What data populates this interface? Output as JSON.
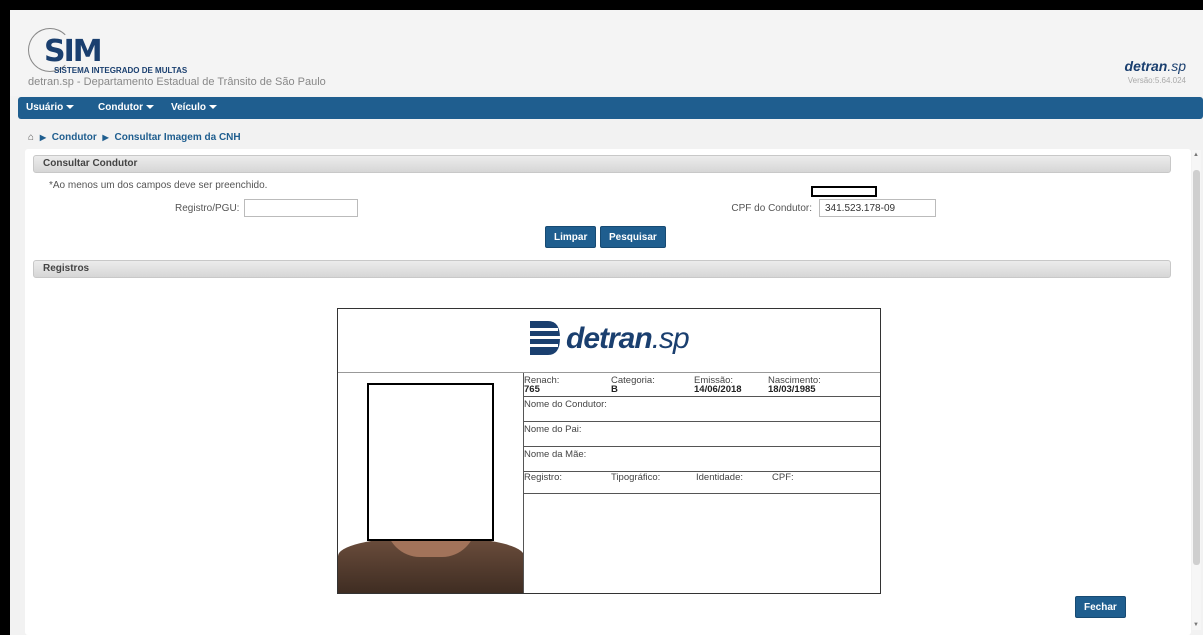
{
  "header": {
    "logo_text": "SIM",
    "logo_subtitle": "SISTEMA INTEGRADO DE MULTAS",
    "department": "detran.sp - Departamento Estadual de Trânsito de São Paulo",
    "brand_main": "detran",
    "brand_suffix": ".sp",
    "version": "Versão:5.64.024"
  },
  "menu": {
    "items": [
      {
        "label": "Usuário"
      },
      {
        "label": "Condutor"
      },
      {
        "label": "Veículo"
      }
    ]
  },
  "breadcrumb": {
    "home_icon": "home-icon",
    "items": [
      "Condutor",
      "Consultar Imagem da CNH"
    ]
  },
  "search": {
    "section_title": "Consultar Condutor",
    "hint": "*Ao menos um dos campos deve ser preenchido.",
    "registro_label": "Registro/PGU:",
    "registro_value": "",
    "cpf_label": "CPF do Condutor:",
    "cpf_value": "341.523.178-09",
    "clear_label": "Limpar",
    "search_label": "Pesquisar"
  },
  "results": {
    "section_title": "Registros",
    "card": {
      "brand_main": "detran",
      "brand_suffix": ".sp",
      "renach_label": "Renach:",
      "renach_value": "765",
      "categoria_label": "Categoria:",
      "categoria_value": "B",
      "emissao_label": "Emissão:",
      "emissao_value": "14/06/2018",
      "nascimento_label": "Nascimento:",
      "nascimento_value": "18/03/1985",
      "nome_condutor_label": "Nome do Condutor:",
      "nome_pai_label": "Nome do Pai:",
      "nome_mae_label": "Nome da Mãe:",
      "registro_label": "Registro:",
      "tipografico_label": "Tipográfico:",
      "identidade_label": "Identidade:",
      "cpf_label": "CPF:"
    }
  },
  "actions": {
    "close_label": "Fechar"
  },
  "colors": {
    "primary": "#1f5e8f",
    "brand": "#1a3f6f"
  }
}
